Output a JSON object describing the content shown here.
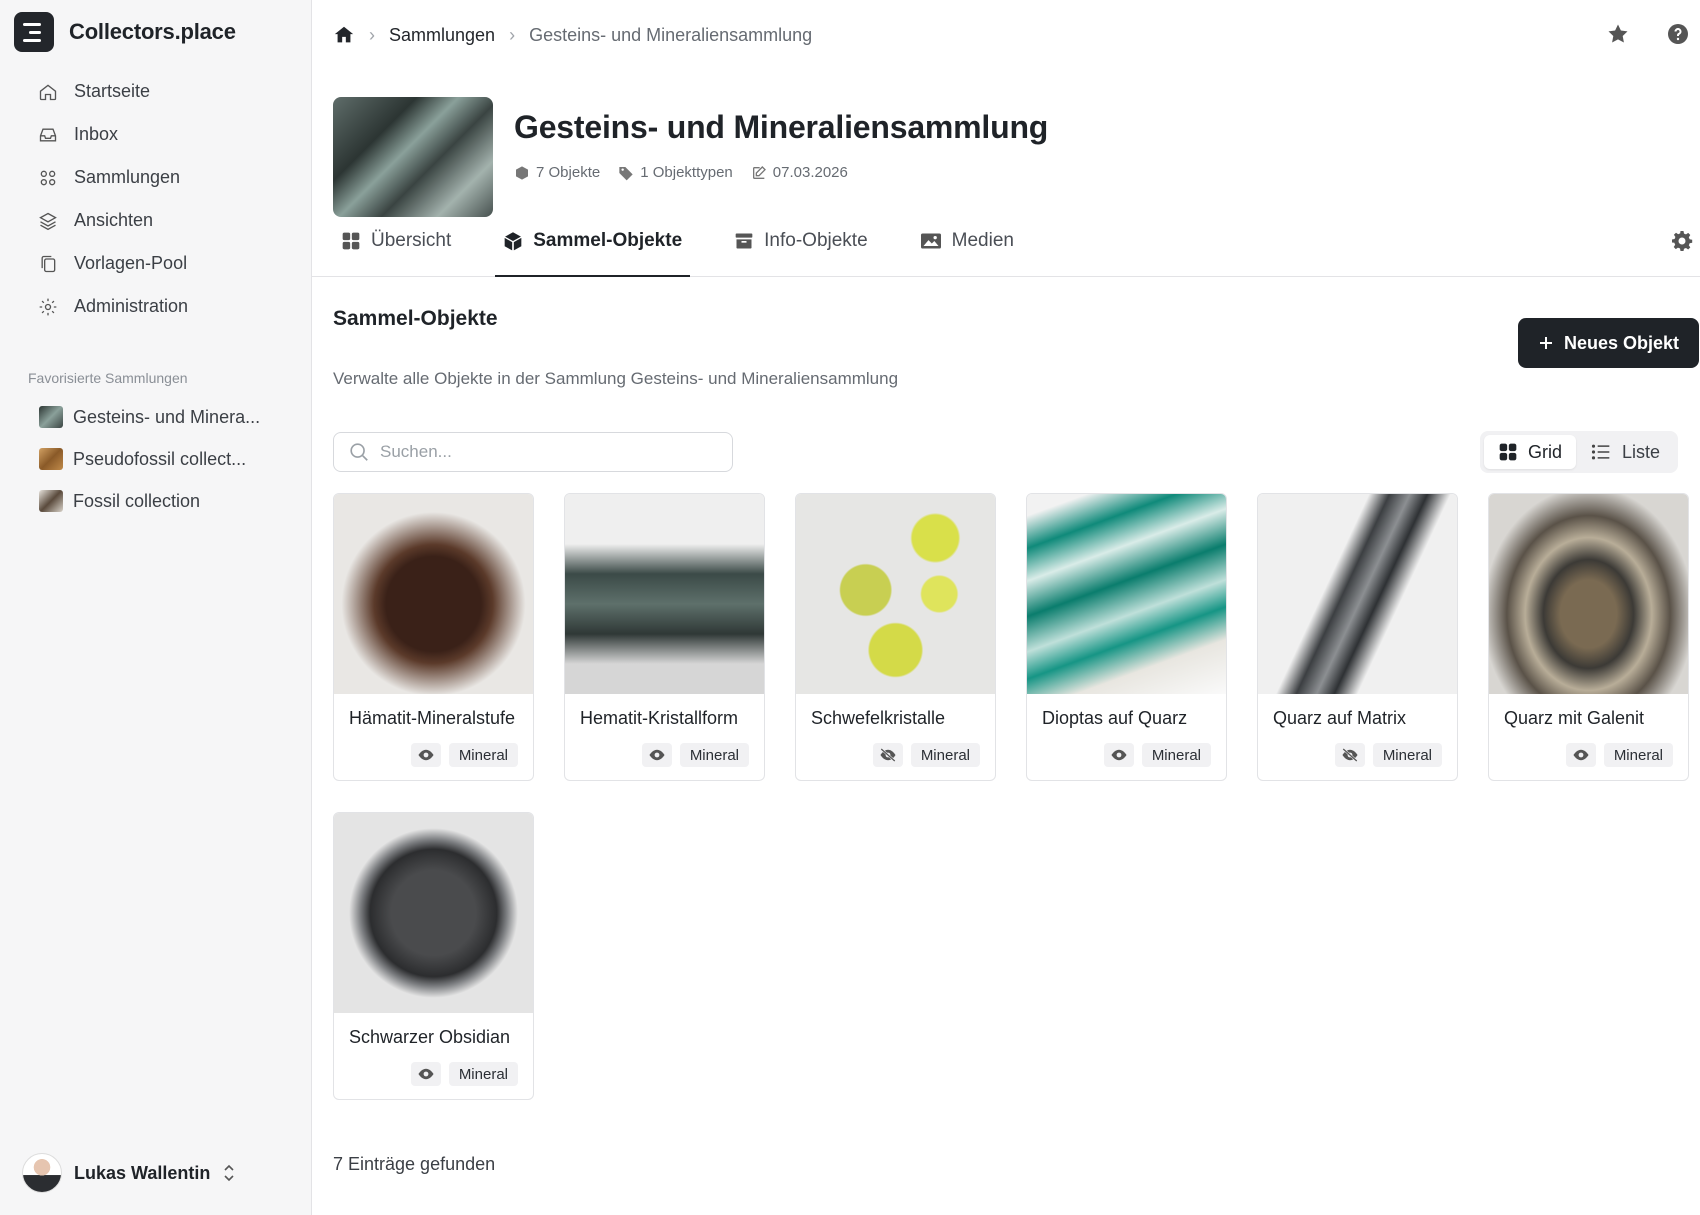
{
  "brand": {
    "name": "Collectors.place"
  },
  "nav": [
    {
      "label": "Startseite",
      "icon": "home-icon"
    },
    {
      "label": "Inbox",
      "icon": "inbox-icon"
    },
    {
      "label": "Sammlungen",
      "icon": "grid-icon"
    },
    {
      "label": "Ansichten",
      "icon": "layers-icon"
    },
    {
      "label": "Vorlagen-Pool",
      "icon": "copy-icon"
    },
    {
      "label": "Administration",
      "icon": "gear-icon"
    }
  ],
  "favorites": {
    "label": "Favorisierte Sammlungen",
    "items": [
      {
        "label": "Gesteins- und Minera...",
        "color": "#4f5b59"
      },
      {
        "label": "Pseudofossil collect...",
        "color": "#b07a3c"
      },
      {
        "label": "Fossil collection",
        "color": "#c9c2b8"
      }
    ]
  },
  "user": {
    "name": "Lukas Wallentin"
  },
  "breadcrumb": {
    "level1": "Sammlungen",
    "level2": "Gesteins- und Mineraliensammlung"
  },
  "collection": {
    "title": "Gesteins- und Mineraliensammlung",
    "objects": "7 Objekte",
    "types": "1 Objekttypen",
    "date": "07.03.2026"
  },
  "tabs": [
    {
      "label": "Übersicht",
      "icon": "dashboard-icon"
    },
    {
      "label": "Sammel-Objekte",
      "icon": "cube-icon"
    },
    {
      "label": "Info-Objekte",
      "icon": "archive-icon"
    },
    {
      "label": "Medien",
      "icon": "image-icon"
    }
  ],
  "section": {
    "title": "Sammel-Objekte",
    "description": "Verwalte alle Objekte in der Sammlung Gesteins- und Mineraliensammlung",
    "new_button": "Neues Objekt"
  },
  "search": {
    "placeholder": "Suchen..."
  },
  "view": {
    "grid": "Grid",
    "list": "Liste"
  },
  "items": [
    {
      "name": "Hämatit-Mineralstufe",
      "tag": "Mineral",
      "visible": true
    },
    {
      "name": "Hematit-Kristallform",
      "tag": "Mineral",
      "visible": true
    },
    {
      "name": "Schwefelkristalle",
      "tag": "Mineral",
      "visible": false
    },
    {
      "name": "Dioptas auf Quarz",
      "tag": "Mineral",
      "visible": true
    },
    {
      "name": "Quarz auf Matrix",
      "tag": "Mineral",
      "visible": false
    },
    {
      "name": "Quarz mit Galenit",
      "tag": "Mineral",
      "visible": true
    },
    {
      "name": "Schwarzer Obsidian",
      "tag": "Mineral",
      "visible": true
    }
  ],
  "footer": {
    "count": "7 Einträge gefunden"
  }
}
